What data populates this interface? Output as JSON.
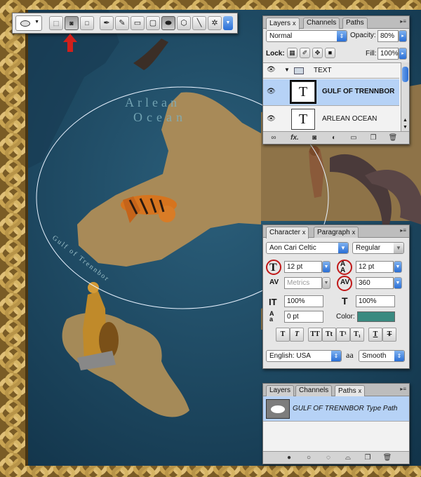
{
  "map": {
    "ocean_label_line1": "Arlean",
    "ocean_label_line2": "Ocean",
    "gulf_label": "Gulf of Trennbor",
    "colors": {
      "sea": "#1e4a64",
      "land": "#a88a58",
      "knot": "#b89448"
    }
  },
  "toolbar": {
    "preset_icon": "ellipse-icon",
    "tools": [
      "paths-mode-icon",
      "shape-layers-mode-icon",
      "fill-pixels-mode-icon",
      "pen-icon",
      "freeform-pen-icon",
      "rectangle-icon",
      "rounded-rectangle-icon",
      "ellipse-icon",
      "polygon-icon",
      "line-icon",
      "custom-shape-icon"
    ],
    "selected_tool": "ellipse-icon",
    "arrow_color": "#d0201b"
  },
  "layers_panel": {
    "tabs": [
      "Layers",
      "Channels",
      "Paths"
    ],
    "active_tab": "Layers",
    "blend_mode": "Normal",
    "opacity_label": "Opacity:",
    "opacity": "80%",
    "lock_label": "Lock:",
    "fill_label": "Fill:",
    "fill": "100%",
    "group_name": "TEXT",
    "layers": [
      {
        "name": "GULF OF TRENNBOR",
        "thumb": "T",
        "selected": true
      },
      {
        "name": "ARLEAN OCEAN",
        "thumb": "T",
        "selected": false
      }
    ],
    "bottom_icons": [
      "link-icon",
      "fx-icon",
      "mask-icon",
      "adjustment-icon",
      "group-icon",
      "new-layer-icon",
      "trash-icon"
    ],
    "fx_text": "fx."
  },
  "character_panel": {
    "tabs": [
      "Character",
      "Paragraph"
    ],
    "active_tab": "Character",
    "font_family": "Aon Cari Celtic",
    "font_style": "Regular",
    "font_size": "12 pt",
    "leading": "12 pt",
    "kerning": "Metrics",
    "tracking": "360",
    "vertical_scale": "100%",
    "horizontal_scale": "100%",
    "baseline_shift": "0 pt",
    "color_label": "Color:",
    "color": "#3a8a80",
    "style_buttons": [
      "T",
      "T",
      "TT",
      "Tt",
      "T¹",
      "T₁",
      "T",
      "T"
    ],
    "language": "English: USA",
    "aa_glyph": "aa",
    "antialias": "Smooth",
    "highlight_color": "#c01818"
  },
  "paths_panel": {
    "tabs": [
      "Layers",
      "Channels",
      "Paths"
    ],
    "active_tab": "Paths",
    "path_name": "GULF OF TRENNBOR Type Path",
    "bottom_icons": [
      "fill-path-icon",
      "stroke-path-icon",
      "load-selection-icon",
      "make-path-icon",
      "new-path-icon",
      "trash-icon"
    ]
  },
  "glyphs": {
    "eye": "👁",
    "close": "x",
    "menu": "▸≡",
    "chev_down": "▼",
    "chev_up": "▲",
    "updown": "⇕",
    "folder": "▭",
    "disclosure": "▼"
  }
}
